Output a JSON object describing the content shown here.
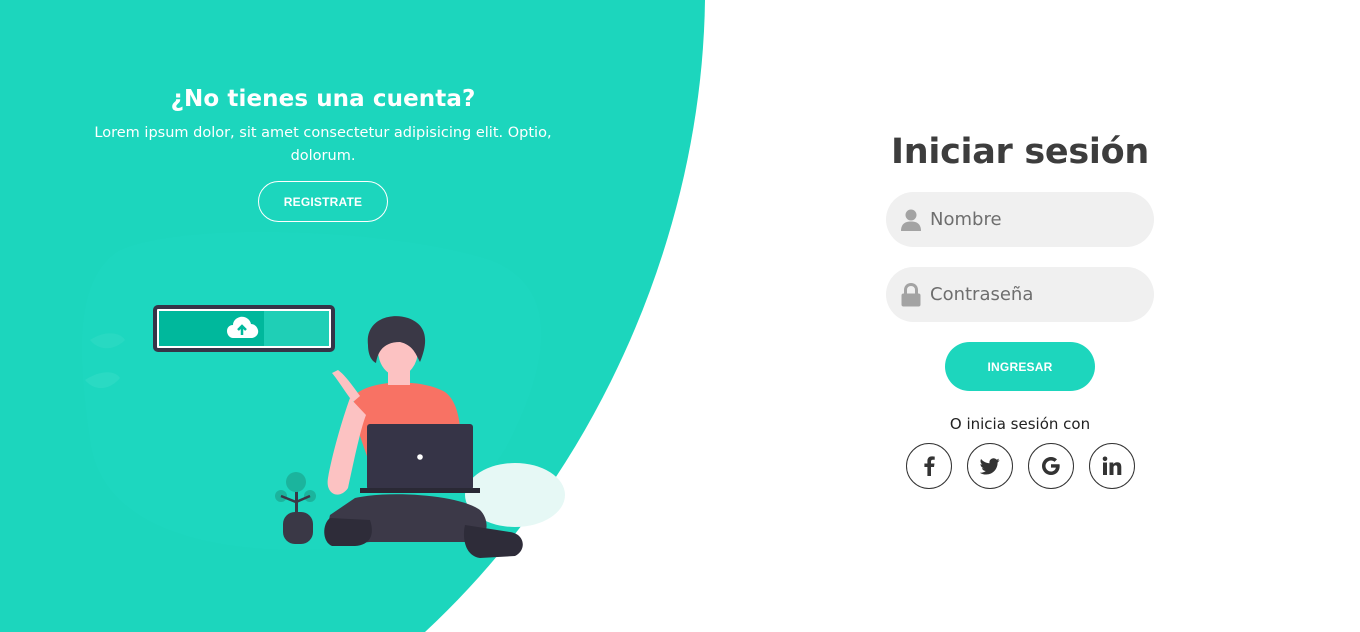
{
  "colors": {
    "teal": "#1cd6bd",
    "dark_text": "#3d3d3d",
    "field_bg": "#f0f0f0",
    "white": "#ffffff"
  },
  "left_panel": {
    "title": "¿No tienes una cuenta?",
    "description": "Lorem ipsum dolor, sit amet consectetur adipisicing elit. Optio, dolorum.",
    "register_button": "REGISTRATE"
  },
  "login_form": {
    "title": "Iniciar sesión",
    "username_placeholder": "Nombre",
    "username_icon": "user-icon",
    "password_placeholder": "Contraseña",
    "password_icon": "lock-icon",
    "submit_button": "INGRESAR",
    "social_prompt": "O inicia sesión con",
    "social_links": [
      {
        "label": "f",
        "icon": "facebook-icon"
      },
      {
        "label": "twitter",
        "icon": "twitter-icon"
      },
      {
        "label": "G",
        "icon": "google-icon"
      },
      {
        "label": "in",
        "icon": "linkedin-icon"
      }
    ]
  }
}
